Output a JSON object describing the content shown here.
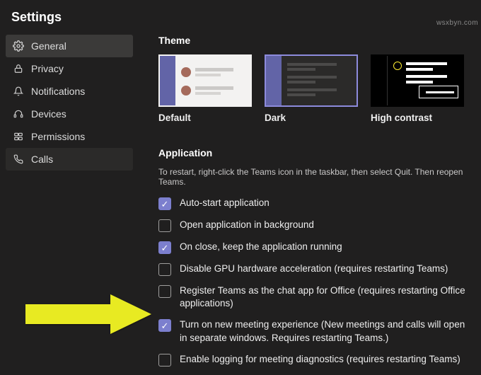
{
  "title": "Settings",
  "sidebar": {
    "items": [
      {
        "label": "General"
      },
      {
        "label": "Privacy"
      },
      {
        "label": "Notifications"
      },
      {
        "label": "Devices"
      },
      {
        "label": "Permissions"
      },
      {
        "label": "Calls"
      }
    ]
  },
  "theme": {
    "heading": "Theme",
    "options": [
      {
        "label": "Default"
      },
      {
        "label": "Dark"
      },
      {
        "label": "High contrast"
      }
    ]
  },
  "application": {
    "heading": "Application",
    "hint": "To restart, right-click the Teams icon in the taskbar, then select Quit. Then reopen Teams.",
    "options": [
      {
        "checked": true,
        "label": "Auto-start application"
      },
      {
        "checked": false,
        "label": "Open application in background"
      },
      {
        "checked": true,
        "label": "On close, keep the application running"
      },
      {
        "checked": false,
        "label": "Disable GPU hardware acceleration (requires restarting Teams)"
      },
      {
        "checked": false,
        "label": "Register Teams as the chat app for Office (requires restarting Office applications)"
      },
      {
        "checked": true,
        "label": "Turn on new meeting experience (New meetings and calls will open in separate windows. Requires restarting Teams.)"
      },
      {
        "checked": false,
        "label": "Enable logging for meeting diagnostics (requires restarting Teams)"
      }
    ]
  },
  "watermark": "wsxbyn.com"
}
